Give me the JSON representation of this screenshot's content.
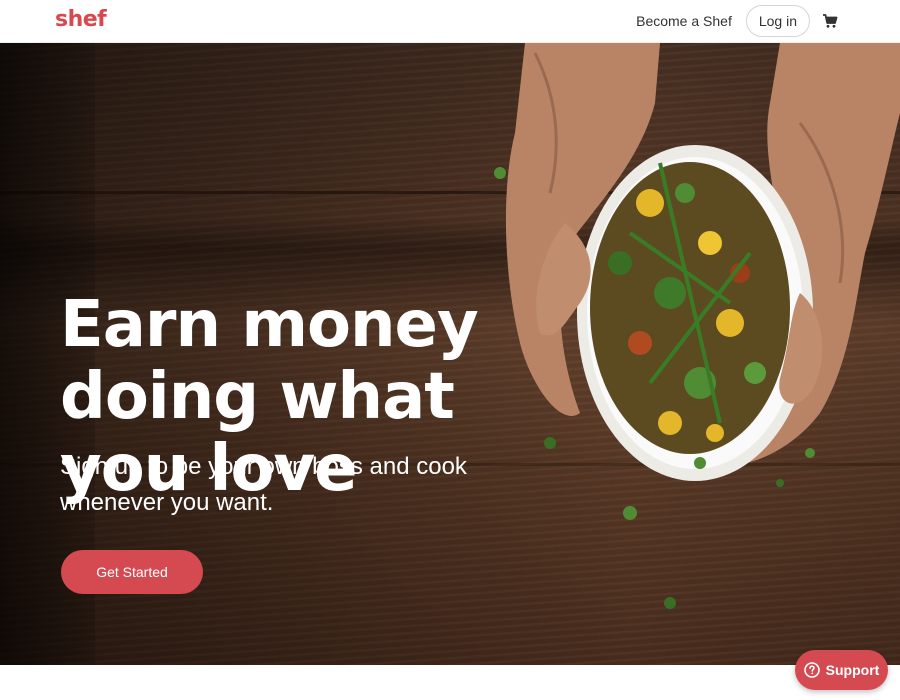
{
  "header": {
    "logo": "shef",
    "become_link": "Become a Shef",
    "login_label": "Log in",
    "cart_icon": "shopping-cart-icon"
  },
  "hero": {
    "headline": "Earn money doing what you love",
    "subhead": "Sign up to be your own boss and cook whenever you want.",
    "cta_label": "Get Started"
  },
  "support": {
    "label": "Support",
    "icon": "question-circle-icon"
  },
  "colors": {
    "brand": "#d9484e",
    "button": "#d44a50"
  }
}
